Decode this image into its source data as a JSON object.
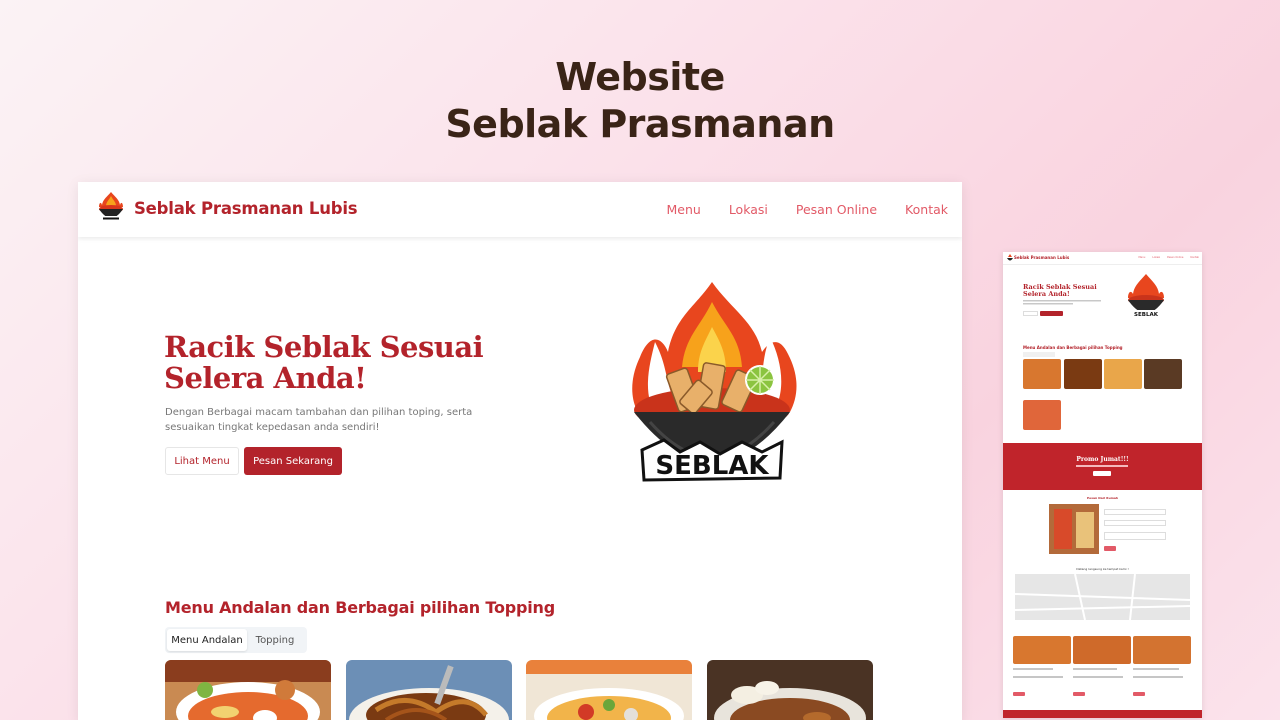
{
  "page_title": {
    "line1": "Website",
    "line2": "Seblak Prasmanan"
  },
  "site": {
    "brand": "Seblak Prasmanan Lubis",
    "nav": [
      {
        "label": "Menu"
      },
      {
        "label": "Lokasi"
      },
      {
        "label": "Pesan Online"
      },
      {
        "label": "Kontak"
      }
    ],
    "hero": {
      "title_line1": "Racik Seblak Sesuai",
      "title_line2": "Selera Anda!",
      "description": "Dengan Berbagai macam tambahan dan pilihan toping, serta sesuaikan tingkat kepedasan anda sendiri!",
      "btn_menu": "Lihat Menu",
      "btn_order": "Pesan Sekarang"
    },
    "logo_text": "SEBLAK",
    "menu_section": {
      "title": "Menu Andalan dan Berbagai pilihan Topping",
      "tabs": [
        "Menu Andalan",
        "Topping"
      ]
    }
  },
  "mini": {
    "brand": "Seblak Prasmanan Lubis",
    "nav": [
      "Menu",
      "Lokasi",
      "Pesan Online",
      "Kontak"
    ],
    "hero_line1": "Racik Seblak Sesuai",
    "hero_line2": "Selera Anda!",
    "logo_text": "SEBLAK",
    "menu_title": "Menu Andalan dan Berbagai pilihan Topping",
    "promo_title": "Promo Jumat!!!",
    "form_title": "Pesan Dari Rumah",
    "map_title": "Datang langsung ke tempat kami !"
  },
  "colors": {
    "brand_red": "#b3232b",
    "nav_link": "#e25a67",
    "title_brown": "#3a2417",
    "promo_red": "#c0242b"
  }
}
